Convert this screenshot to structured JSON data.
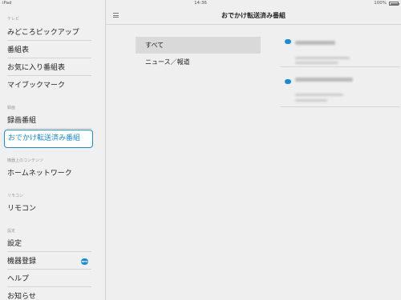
{
  "status": {
    "carrier": "iPad",
    "time": "14:36",
    "battery_text": "100%",
    "battery_level": 1.0
  },
  "header": {
    "title": "おでかけ転送済み番組",
    "menu_icon": "hamburger-icon"
  },
  "sidebar": {
    "sections": [
      {
        "header": "テレビ",
        "items": [
          {
            "label": "みどころピックアップ"
          },
          {
            "label": "番組表"
          },
          {
            "label": "お気に入り番組表"
          },
          {
            "label": "マイブックマーク"
          }
        ]
      },
      {
        "header": "録画",
        "items": [
          {
            "label": "録画番組"
          },
          {
            "label": "おでかけ転送済み番組",
            "selected": true
          }
        ]
      },
      {
        "header": "機器上のコンテンツ",
        "items": [
          {
            "label": "ホームネットワーク"
          }
        ]
      },
      {
        "header": "リモコン",
        "items": [
          {
            "label": "リモコン"
          }
        ]
      },
      {
        "header": "設定",
        "items": [
          {
            "label": "設定"
          },
          {
            "label": "機器登録",
            "badge": "NEW"
          },
          {
            "label": "ヘルプ"
          },
          {
            "label": "お知らせ"
          }
        ]
      }
    ]
  },
  "filters": [
    {
      "label": "すべて",
      "active": true
    },
    {
      "label": "ニュース／報道",
      "active": false
    }
  ],
  "programs": [
    {
      "badge": "NEW"
    },
    {
      "badge": "NEW"
    }
  ],
  "colors": {
    "accent": "#1a8ad9",
    "sidebar_bg": "#f0f0f0",
    "main_bg": "#efefef",
    "active_filter_bg": "#d9d9d9"
  }
}
